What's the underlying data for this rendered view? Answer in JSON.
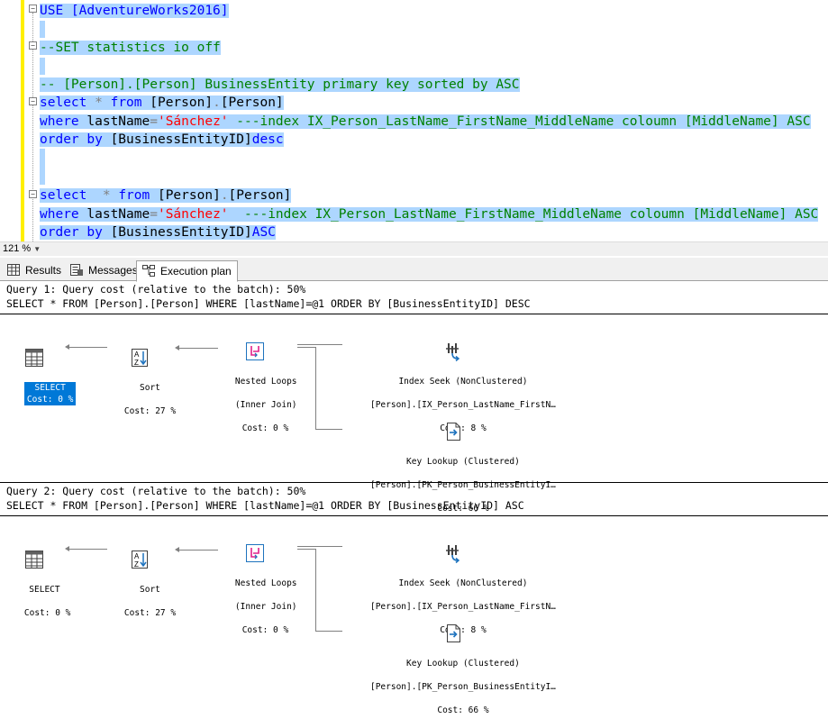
{
  "editor": {
    "lines": {
      "l1": "USE [AdventureWorks2016]",
      "l3": "--SET statistics io off",
      "l5": "-- [Person].[Person] BusinessEntity primary key sorted by ASC",
      "l6a": "select",
      "l6b": " * ",
      "l6c": "from",
      "l6d": " [Person]",
      "l6e": ".",
      "l6f": "[Person]",
      "l7a": "where",
      "l7b": " lastName",
      "l7c": "=",
      "l7d": "'Sánchez'",
      "l7e": " ---index IX_Person_LastName_FirstName_MiddleName coloumn [MiddleName] ASC",
      "l8a": "order by",
      "l8b": " [BusinessEntityID]",
      "l8c": "desc",
      "l11a": "select",
      "l11b": "  * ",
      "l11c": "from",
      "l11d": " [Person]",
      "l11e": ".",
      "l11f": "[Person]",
      "l12a": "where",
      "l12b": " lastName",
      "l12c": "=",
      "l12d": "'Sánchez'",
      "l12e": "  ---index IX_Person_LastName_FirstName_MiddleName coloumn [MiddleName] ASC",
      "l13a": "order by",
      "l13b": " [BusinessEntityID]",
      "l13c": "ASC"
    }
  },
  "zoom": "121 %",
  "tabs": [
    {
      "label": "Results",
      "icon": "grid-icon"
    },
    {
      "label": "Messages",
      "icon": "messages-icon"
    },
    {
      "label": "Execution plan",
      "icon": "execution-plan-icon"
    }
  ],
  "queries": [
    {
      "header": "Query 1: Query cost (relative to the batch): 50%",
      "sql": "SELECT * FROM [Person].[Person] WHERE [lastName]=@1 ORDER BY [BusinessEntityID] DESC",
      "select": {
        "label": "SELECT",
        "cost": "Cost: 0 %"
      },
      "sort": {
        "label": "Sort",
        "cost": "Cost: 27 %"
      },
      "nested": {
        "label": "Nested Loops",
        "sub": "(Inner Join)",
        "cost": "Cost: 0 %"
      },
      "seek": {
        "label": "Index Seek (NonClustered)",
        "obj": "[Person].[IX_Person_LastName_FirstN…",
        "cost": "Cost: 8 %"
      },
      "lookup": {
        "label": "Key Lookup (Clustered)",
        "obj": "[Person].[PK_Person_BusinessEntityI…",
        "cost": "Cost: 66 %"
      }
    },
    {
      "header": "Query 2: Query cost (relative to the batch): 50%",
      "sql": "SELECT * FROM [Person].[Person] WHERE [lastName]=@1 ORDER BY [BusinessEntityID] ASC",
      "select": {
        "label": "SELECT",
        "cost": "Cost: 0 %"
      },
      "sort": {
        "label": "Sort",
        "cost": "Cost: 27 %"
      },
      "nested": {
        "label": "Nested Loops",
        "sub": "(Inner Join)",
        "cost": "Cost: 0 %"
      },
      "seek": {
        "label": "Index Seek (NonClustered)",
        "obj": "[Person].[IX_Person_LastName_FirstN…",
        "cost": "Cost: 8 %"
      },
      "lookup": {
        "label": "Key Lookup (Clustered)",
        "obj": "[Person].[PK_Person_BusinessEntityI…",
        "cost": "Cost: 66 %"
      }
    }
  ],
  "colors": {
    "selection": "#add6ff",
    "keyword": "#0000ff",
    "string": "#ff0000",
    "comment": "#008000",
    "selected_node": "#0078d7"
  }
}
